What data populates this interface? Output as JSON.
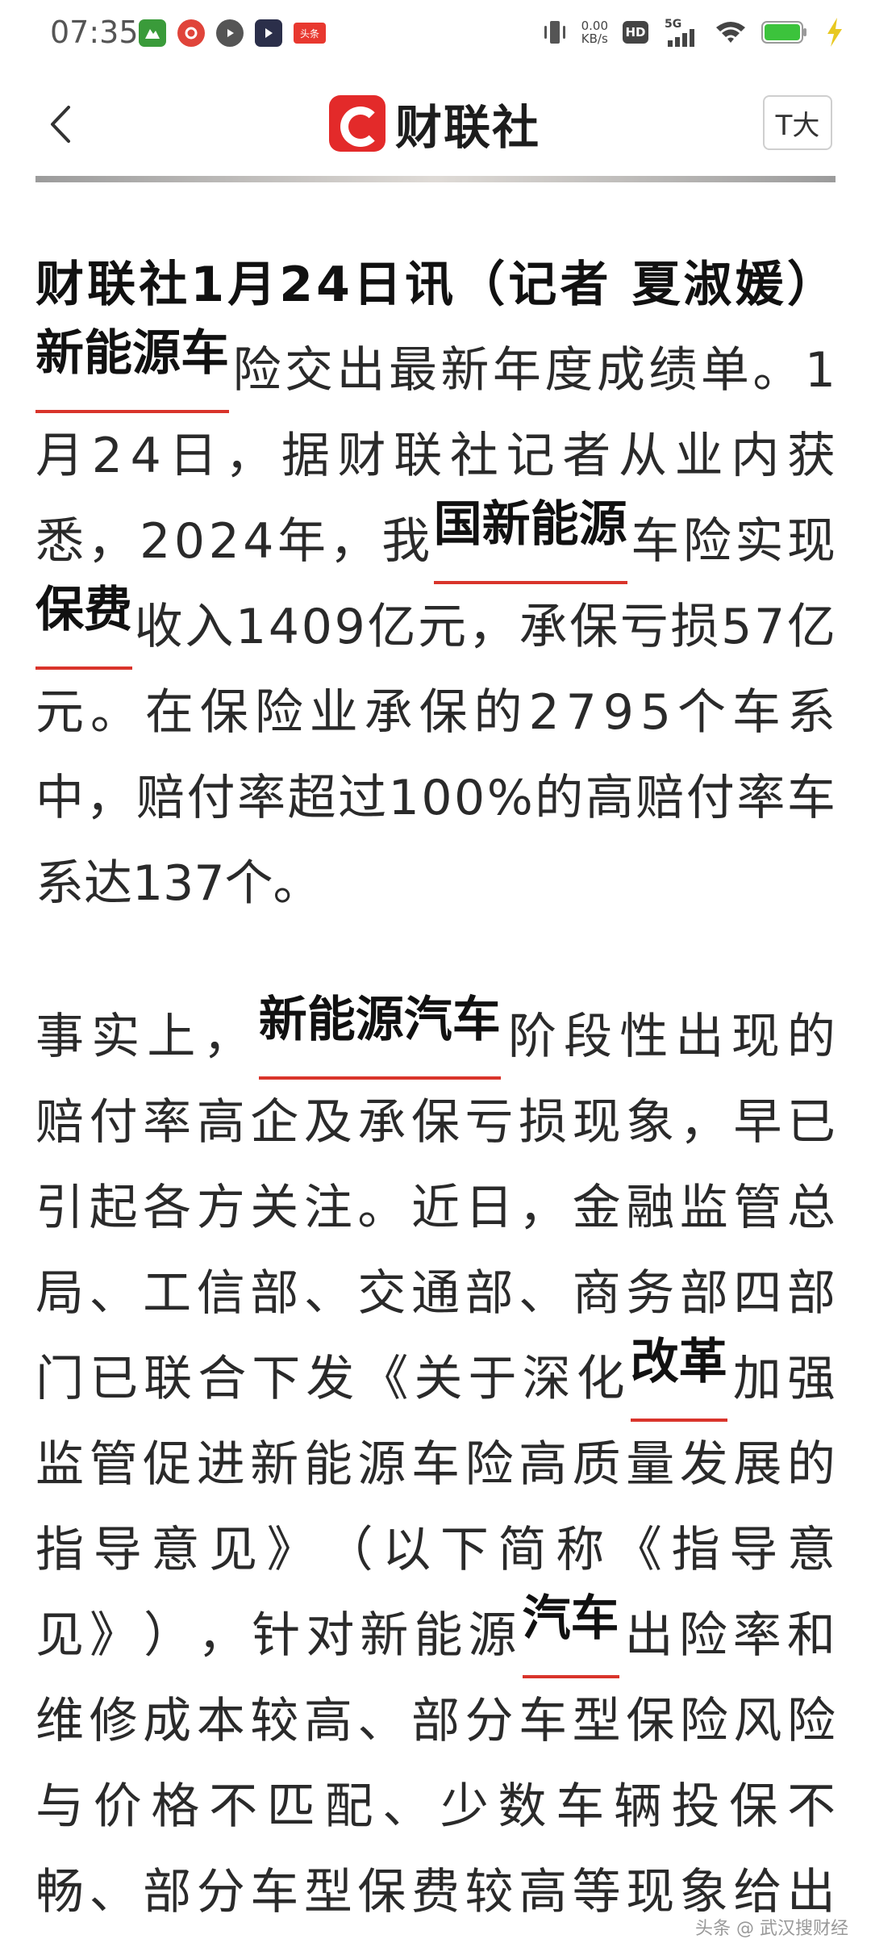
{
  "status_bar": {
    "time": "07:35",
    "net_speed_value": "0.00",
    "net_speed_unit": "KB/s",
    "hd_label": "HD",
    "network_label": "5G",
    "notification_icons": [
      "app-green-icon",
      "app-red-icon",
      "app-play-icon",
      "app-dark-icon",
      "toutiao-icon"
    ],
    "toutiao_label": "头条"
  },
  "app_bar": {
    "logo_text": "财联社",
    "font_size_label": "T大",
    "back_icon": "chevron-left-icon"
  },
  "article": {
    "lines": [
      {
        "segments": [
          {
            "text": "财联社1月24日讯（记者 夏淑媛）",
            "style": "bold"
          }
        ]
      },
      {
        "segments": [
          {
            "text": "新能源车",
            "style": "keyword"
          },
          {
            "text": "险交出最新年度成绩单。1",
            "style": "normal"
          }
        ]
      },
      {
        "segments": [
          {
            "text": "月24日，据财联社记者从业内获",
            "style": "normal"
          }
        ]
      },
      {
        "segments": [
          {
            "text": "悉，2024年，我",
            "style": "normal"
          },
          {
            "text": "国新能源",
            "style": "keyword"
          },
          {
            "text": "车险实现",
            "style": "normal"
          }
        ]
      },
      {
        "segments": [
          {
            "text": "保费",
            "style": "keyword"
          },
          {
            "text": "收入1409亿元，承保亏损57亿",
            "style": "normal"
          }
        ]
      },
      {
        "segments": [
          {
            "text": "元。在保险业承保的2795个车系",
            "style": "normal"
          }
        ]
      },
      {
        "segments": [
          {
            "text": "中，赔付率超过100%的高赔付率车",
            "style": "normal"
          }
        ]
      },
      {
        "segments": [
          {
            "text": "系达137个。",
            "style": "normal"
          }
        ],
        "last": true
      },
      {
        "segments": [
          {
            "text": "事实上，",
            "style": "normal"
          },
          {
            "text": "新能源汽车",
            "style": "keyword"
          },
          {
            "text": "阶段性出现的",
            "style": "normal"
          }
        ]
      },
      {
        "segments": [
          {
            "text": "赔付率高企及承保亏损现象，早已",
            "style": "normal"
          }
        ]
      },
      {
        "segments": [
          {
            "text": "引起各方关注。近日，金融监管总",
            "style": "normal"
          }
        ]
      },
      {
        "segments": [
          {
            "text": "局、工信部、交通部、商务部四部",
            "style": "normal"
          }
        ]
      },
      {
        "segments": [
          {
            "text": "门已联合下发《关于深化",
            "style": "normal"
          },
          {
            "text": "改革",
            "style": "keyword"
          },
          {
            "text": "加强",
            "style": "normal"
          }
        ]
      },
      {
        "segments": [
          {
            "text": "监管促进新能源车险高质量发展的",
            "style": "normal"
          }
        ]
      },
      {
        "segments": [
          {
            "text": "指导意见》（以下简称《指导意",
            "style": "normal"
          }
        ]
      },
      {
        "segments": [
          {
            "text": "见》），针对新能源",
            "style": "normal"
          },
          {
            "text": "汽车",
            "style": "keyword"
          },
          {
            "text": "出险率和",
            "style": "normal"
          }
        ]
      },
      {
        "segments": [
          {
            "text": "维修成本较高、部分车型保险风险",
            "style": "normal"
          }
        ]
      },
      {
        "segments": [
          {
            "text": "与价格不匹配、少数车辆投保不",
            "style": "normal"
          }
        ]
      },
      {
        "segments": [
          {
            "text": "畅、部分车型保费较高等现象给出",
            "style": "normal"
          }
        ]
      }
    ]
  },
  "watermark": "头条 @ 武汉搜财经",
  "colors": {
    "accent_red": "#e32a2a",
    "keyword_underline": "#d9342b",
    "text": "#2a2a2a"
  }
}
